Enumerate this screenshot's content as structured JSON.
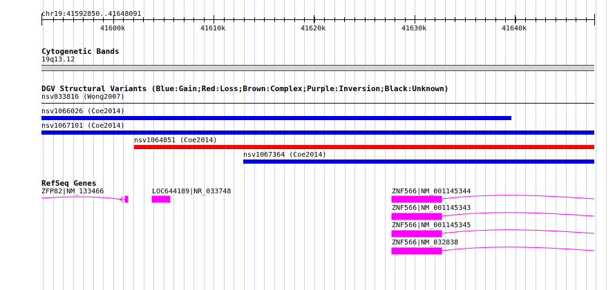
{
  "ruler": {
    "location": "chr19:41592850..41648091",
    "ticks": [
      "41600k",
      "41610k",
      "41620k",
      "41630k",
      "41640k"
    ]
  },
  "cytoband": {
    "title": "Cytogenetic Bands",
    "band": "19q13.12"
  },
  "dgv": {
    "title": "DGV Structural Variants (Blue:Gain;Red:Loss;Brown:Complex;Purple:Inversion;Black:Unknown)",
    "variants": [
      {
        "label": "nsv833816 (Wong2007)",
        "type": "Black:Unknown",
        "color": "#00006f"
      },
      {
        "label": "nsv1066026 (Coe2014)",
        "type": "Blue:Gain",
        "color": "#0000e0"
      },
      {
        "label": "nsv1067101 (Coe2014)",
        "type": "Blue:Gain",
        "color": "#0000e0"
      },
      {
        "label": "nsv1064851 (Coe2014)",
        "type": "Red:Loss",
        "color": "#ff0000"
      },
      {
        "label": "nsv1067364 (Coe2014)",
        "type": "Blue:Gain",
        "color": "#0000e0"
      }
    ]
  },
  "refseq": {
    "title": "RefSeq Genes",
    "gene_color": "#ff00ff",
    "genes": [
      {
        "label": "ZFP82|NM_133466"
      },
      {
        "label": "LOC644189|NR_033748"
      },
      {
        "label": "ZNF566|NM_001145344"
      },
      {
        "label": "ZNF566|NM_001145343"
      },
      {
        "label": "ZNF566|NM_001145345"
      },
      {
        "label": "ZNF566|NM_032838"
      }
    ]
  }
}
